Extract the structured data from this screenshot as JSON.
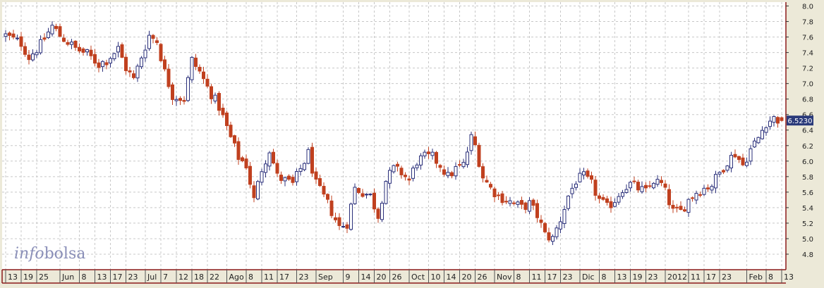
{
  "brand": {
    "logo_text": "infobolsa",
    "logo_part1": "info",
    "logo_part2": "bolsa"
  },
  "colors": {
    "background": "#ffffff",
    "frame": "#ece9d8",
    "border": "#8b1a1a",
    "grid": "#c8c8c8",
    "up": "#2a2f7a",
    "down": "#c0401f",
    "price_label_bg": "#2a3a7a",
    "logo": "#8a8fb8"
  },
  "chart_data": {
    "type": "candlestick",
    "title": "",
    "xlabel": "",
    "ylabel": "",
    "ylim": [
      4.6,
      8.05
    ],
    "y_ticks": [
      4.8,
      5.0,
      5.2,
      5.4,
      5.6,
      5.8,
      6.0,
      6.2,
      6.4,
      6.6,
      6.8,
      7.0,
      7.2,
      7.4,
      7.6,
      7.8,
      8.0
    ],
    "last_price": "6.5230",
    "last_price_value": 6.523,
    "grid": true,
    "x_ticks": [
      {
        "label": "13",
        "i": 0,
        "kind": "minor"
      },
      {
        "label": "19",
        "i": 4,
        "kind": "minor"
      },
      {
        "label": "25",
        "i": 8,
        "kind": "minor"
      },
      {
        "label": "Jun",
        "i": 14,
        "kind": "month"
      },
      {
        "label": "8",
        "i": 19,
        "kind": "minor"
      },
      {
        "label": "13",
        "i": 23,
        "kind": "minor"
      },
      {
        "label": "17",
        "i": 27,
        "kind": "minor"
      },
      {
        "label": "23",
        "i": 31,
        "kind": "minor"
      },
      {
        "label": "Jul",
        "i": 36,
        "kind": "month"
      },
      {
        "label": "7",
        "i": 40,
        "kind": "minor"
      },
      {
        "label": "12",
        "i": 44,
        "kind": "minor"
      },
      {
        "label": "18",
        "i": 48,
        "kind": "minor"
      },
      {
        "label": "22",
        "i": 52,
        "kind": "minor"
      },
      {
        "label": "Ago",
        "i": 57,
        "kind": "month"
      },
      {
        "label": "8",
        "i": 62,
        "kind": "minor"
      },
      {
        "label": "11",
        "i": 66,
        "kind": "minor"
      },
      {
        "label": "17",
        "i": 70,
        "kind": "minor"
      },
      {
        "label": "23",
        "i": 75,
        "kind": "minor"
      },
      {
        "label": "Sep",
        "i": 80,
        "kind": "month"
      },
      {
        "label": "9",
        "i": 87,
        "kind": "minor"
      },
      {
        "label": "14",
        "i": 91,
        "kind": "minor"
      },
      {
        "label": "20",
        "i": 95,
        "kind": "minor"
      },
      {
        "label": "26",
        "i": 99,
        "kind": "minor"
      },
      {
        "label": "Oct",
        "i": 104,
        "kind": "month"
      },
      {
        "label": "10",
        "i": 109,
        "kind": "minor"
      },
      {
        "label": "14",
        "i": 113,
        "kind": "minor"
      },
      {
        "label": "20",
        "i": 117,
        "kind": "minor"
      },
      {
        "label": "26",
        "i": 121,
        "kind": "minor"
      },
      {
        "label": "Nov",
        "i": 126,
        "kind": "month"
      },
      {
        "label": "8",
        "i": 131,
        "kind": "minor"
      },
      {
        "label": "11",
        "i": 135,
        "kind": "minor"
      },
      {
        "label": "17",
        "i": 139,
        "kind": "minor"
      },
      {
        "label": "23",
        "i": 143,
        "kind": "minor"
      },
      {
        "label": "Dic",
        "i": 148,
        "kind": "month"
      },
      {
        "label": "8",
        "i": 153,
        "kind": "minor"
      },
      {
        "label": "13",
        "i": 157,
        "kind": "minor"
      },
      {
        "label": "19",
        "i": 161,
        "kind": "minor"
      },
      {
        "label": "23",
        "i": 165,
        "kind": "minor"
      },
      {
        "label": "2012",
        "i": 170,
        "kind": "month"
      },
      {
        "label": "11",
        "i": 176,
        "kind": "minor"
      },
      {
        "label": "17",
        "i": 180,
        "kind": "minor"
      },
      {
        "label": "23",
        "i": 184,
        "kind": "minor"
      },
      {
        "label": "Feb",
        "i": 191,
        "kind": "month"
      },
      {
        "label": "8",
        "i": 196,
        "kind": "minor"
      },
      {
        "label": "13",
        "i": 200,
        "kind": "minor"
      }
    ],
    "anchors": [
      [
        0,
        7.62
      ],
      [
        4,
        7.52
      ],
      [
        6,
        7.34
      ],
      [
        9,
        7.5
      ],
      [
        12,
        7.74
      ],
      [
        14,
        7.62
      ],
      [
        18,
        7.45
      ],
      [
        21,
        7.38
      ],
      [
        24,
        7.25
      ],
      [
        26,
        7.3
      ],
      [
        29,
        7.45
      ],
      [
        31,
        7.2
      ],
      [
        33,
        7.05
      ],
      [
        35,
        7.35
      ],
      [
        37,
        7.62
      ],
      [
        39,
        7.55
      ],
      [
        41,
        7.15
      ],
      [
        43,
        6.85
      ],
      [
        46,
        6.8
      ],
      [
        48,
        7.3
      ],
      [
        50,
        7.15
      ],
      [
        52,
        6.95
      ],
      [
        55,
        6.7
      ],
      [
        58,
        6.3
      ],
      [
        60,
        6.05
      ],
      [
        62,
        5.95
      ],
      [
        64,
        5.5
      ],
      [
        66,
        5.9
      ],
      [
        68,
        6.15
      ],
      [
        70,
        5.8
      ],
      [
        72,
        5.75
      ],
      [
        74,
        5.7
      ],
      [
        76,
        5.9
      ],
      [
        78,
        6.1
      ],
      [
        80,
        5.7
      ],
      [
        83,
        5.45
      ],
      [
        86,
        5.15
      ],
      [
        88,
        5.2
      ],
      [
        90,
        5.65
      ],
      [
        92,
        5.6
      ],
      [
        94,
        5.55
      ],
      [
        96,
        5.3
      ],
      [
        98,
        5.75
      ],
      [
        100,
        5.9
      ],
      [
        102,
        5.85
      ],
      [
        104,
        5.75
      ],
      [
        106,
        6.0
      ],
      [
        108,
        6.05
      ],
      [
        110,
        6.05
      ],
      [
        112,
        5.95
      ],
      [
        114,
        5.8
      ],
      [
        116,
        5.9
      ],
      [
        118,
        5.95
      ],
      [
        120,
        6.3
      ],
      [
        121,
        6.2
      ],
      [
        123,
        5.8
      ],
      [
        125,
        5.65
      ],
      [
        127,
        5.55
      ],
      [
        129,
        5.5
      ],
      [
        131,
        5.45
      ],
      [
        133,
        5.4
      ],
      [
        135,
        5.45
      ],
      [
        137,
        5.3
      ],
      [
        139,
        5.05
      ],
      [
        141,
        5.0
      ],
      [
        143,
        5.25
      ],
      [
        145,
        5.55
      ],
      [
        147,
        5.75
      ],
      [
        149,
        5.8
      ],
      [
        151,
        5.7
      ],
      [
        153,
        5.5
      ],
      [
        155,
        5.4
      ],
      [
        157,
        5.5
      ],
      [
        159,
        5.65
      ],
      [
        161,
        5.7
      ],
      [
        163,
        5.65
      ],
      [
        165,
        5.6
      ],
      [
        167,
        5.75
      ],
      [
        169,
        5.7
      ],
      [
        170,
        5.6
      ],
      [
        172,
        5.35
      ],
      [
        174,
        5.35
      ],
      [
        176,
        5.5
      ],
      [
        178,
        5.6
      ],
      [
        180,
        5.65
      ],
      [
        182,
        5.7
      ],
      [
        184,
        5.85
      ],
      [
        186,
        6.0
      ],
      [
        188,
        6.1
      ],
      [
        190,
        5.95
      ],
      [
        192,
        6.15
      ],
      [
        194,
        6.3
      ],
      [
        196,
        6.5
      ],
      [
        198,
        6.55
      ],
      [
        200,
        6.52
      ]
    ],
    "n_candles": 201
  }
}
